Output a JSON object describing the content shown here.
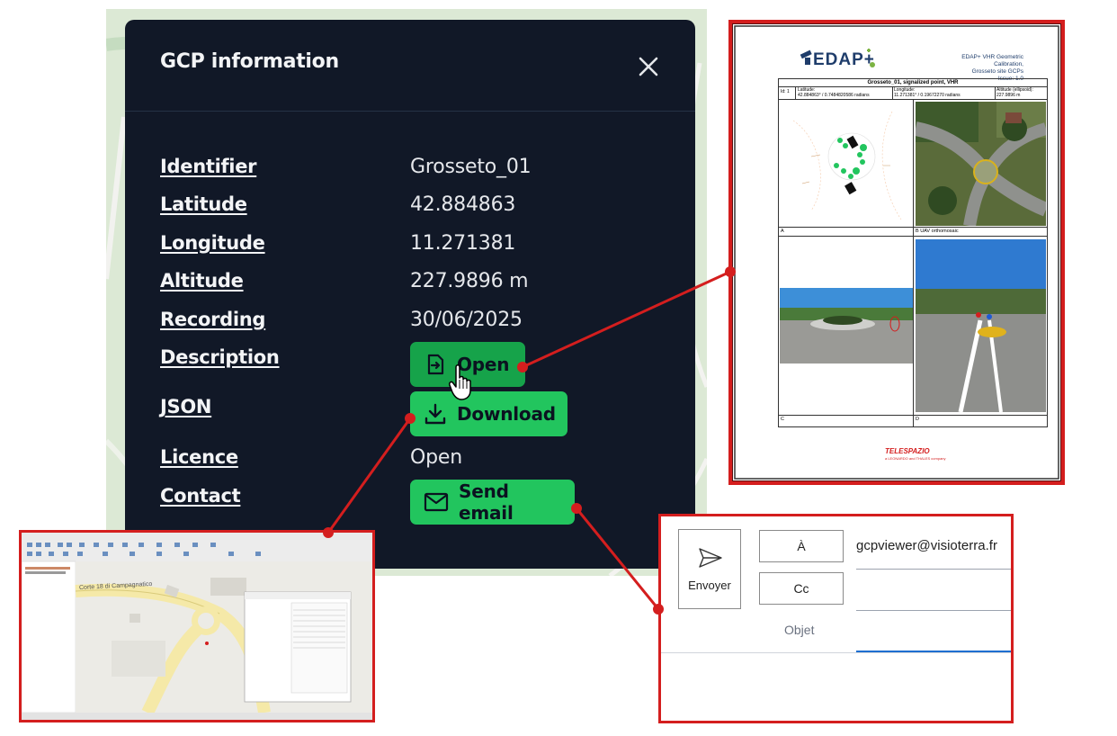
{
  "modal": {
    "title": "GCP information",
    "fields": [
      {
        "label": "Identifier",
        "value": "Grosseto_01"
      },
      {
        "label": "Latitude",
        "value": "42.884863"
      },
      {
        "label": "Longitude",
        "value": "11.271381"
      },
      {
        "label": "Altitude",
        "value": "227.9896 m"
      },
      {
        "label": "Recording",
        "value": "30/06/2025"
      },
      {
        "label": "Description",
        "button": "Open",
        "icon": "open-file-icon"
      },
      {
        "label": "JSON",
        "button": "Download",
        "icon": "download-icon"
      },
      {
        "label": "Licence",
        "value": "Open"
      },
      {
        "label": "Contact",
        "button": "Send email",
        "icon": "mail-icon"
      }
    ],
    "colors": {
      "background": "#111827",
      "button": "#22c55e",
      "button_active": "#16a34a",
      "connector": "#d41e1e"
    }
  },
  "document": {
    "logo_text": "EDAP+",
    "header_lines": [
      "EDAP+ VHR Geometric Calibration,",
      "Grosseto site GCPs",
      "Issue:  1.0"
    ],
    "table_title": "Grosseto_01, signalized point, VHR",
    "id_label": "Id: 1",
    "lat_label": "Latitude:",
    "lat_value": "42.884863° / 0.7484820586 radians",
    "lon_label": "Longitude:",
    "lon_value": "11.271381° / 0.19672270 radians",
    "alt_label": "Altitude (ellipsoid):",
    "alt_value": "227.9896 m",
    "cell_a": "A",
    "cell_b": "B UAV orthomosaic",
    "cell_c": "C",
    "cell_d": "D",
    "footer_brand": "TELESPAZIO",
    "footer_sub": "a LEONARDO and THALES company"
  },
  "qgis": {
    "road_label": "Corte 18 di Campagnatico"
  },
  "mail": {
    "send_label": "Envoyer",
    "to_label": "À",
    "cc_label": "Cc",
    "to_value": "gcpviewer@visioterra.fr",
    "subject_label": "Objet"
  }
}
